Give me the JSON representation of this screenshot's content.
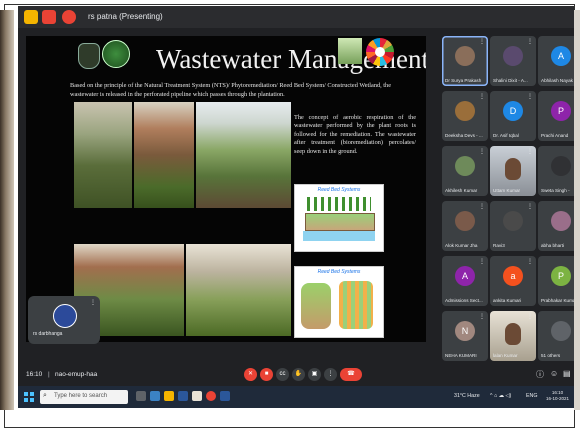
{
  "window": {
    "title": "rs patna (Presenting)"
  },
  "slide": {
    "title": "Wastewater Management",
    "intro": "Based on the principle of the Natural Treatment System (NTS)/ Phytoremediation/ Reed Bed System/ Constructed Wetland, the wastewater is released in the perforated pipeline which passes through the plantation.",
    "right_text": "The concept of aerobic respiration of the wastewater performed by the plant roots is followed for the remediation. The wastewater after treatment (bioremediation) percolates/ seep down in the ground.",
    "diagram1_title": "Reed Bed Systems",
    "diagram2_title": "Reed Bed Systems"
  },
  "self_tile": {
    "name": "rs darbhanga"
  },
  "participants": [
    {
      "name": "Dr Surya Prakash",
      "initial": "",
      "color": "#8a6e5a",
      "active": true
    },
    {
      "name": "Shalini Dixit - A...",
      "initial": "",
      "color": "#5a4a6e"
    },
    {
      "name": "Abhilash Nayak",
      "initial": "A",
      "color": "#1e88e5"
    },
    {
      "name": "Deeksha Devs - ...",
      "initial": "",
      "color": "#9a6e3a"
    },
    {
      "name": "Dr. Asif Iqbal",
      "initial": "D",
      "color": "#1e88e5"
    },
    {
      "name": "Prachi Anand",
      "initial": "P",
      "color": "#8e24aa"
    },
    {
      "name": "Akhilesh Kumar",
      "initial": "",
      "color": "#6e8a5a"
    },
    {
      "name": "Uttam Kumar",
      "initial": "",
      "color": "#c9cfd6",
      "video": true
    },
    {
      "name": "Sweta Singh -",
      "initial": "",
      "color": "#303134"
    },
    {
      "name": "Alok Kumar Jha",
      "initial": "",
      "color": "#7a5a4a"
    },
    {
      "name": "Ravi3",
      "initial": "",
      "color": "#4a4a4a"
    },
    {
      "name": "abha bharti",
      "initial": "",
      "color": "#9a6e8a"
    },
    {
      "name": "Admissions Sect...",
      "initial": "A",
      "color": "#8e24aa"
    },
    {
      "name": "ankita Kumari",
      "initial": "a",
      "color": "#f4511e"
    },
    {
      "name": "Prabhakar Kumar",
      "initial": "P",
      "color": "#7cb342"
    },
    {
      "name": "NEHA KUMARI",
      "initial": "N",
      "color": "#a1887f"
    },
    {
      "name": "lalan Kumar",
      "initial": "",
      "color": "#e8e2d6",
      "video": true
    },
    {
      "name": "51 others",
      "initial": "",
      "color": "#5f6368"
    }
  ],
  "bottom_bar": {
    "time": "16:10",
    "meeting_code": "nao-emup-haa"
  },
  "taskbar": {
    "search_placeholder": "Type here to search",
    "weather": "31°C Haze",
    "lang": "ENG",
    "time": "16:10",
    "date": "16-10-2021"
  },
  "colors": {
    "accent": "#8ab4f8",
    "end_call": "#ea4335"
  }
}
